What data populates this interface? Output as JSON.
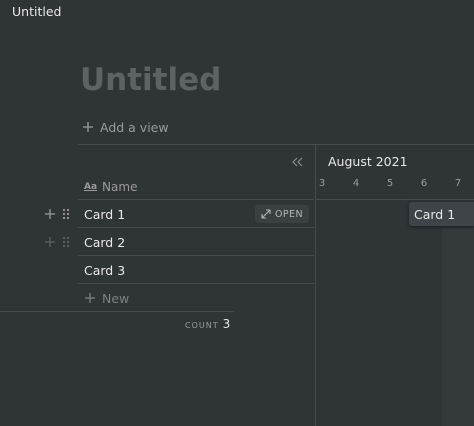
{
  "window": {
    "title": "Untitled"
  },
  "page": {
    "title": "Untitled",
    "add_view_label": "Add a view"
  },
  "table": {
    "column_header": "Name",
    "column_icon_text": "Aa",
    "rows": [
      {
        "label": "Card 1"
      },
      {
        "label": "Card 2"
      },
      {
        "label": "Card 3"
      }
    ],
    "open_label": "OPEN",
    "new_label": "New",
    "count_label": "COUNT",
    "count_value": "3"
  },
  "timeline": {
    "month": "August 2021",
    "days": [
      "3",
      "4",
      "5",
      "6",
      "7"
    ],
    "card_label": "Card 1"
  }
}
